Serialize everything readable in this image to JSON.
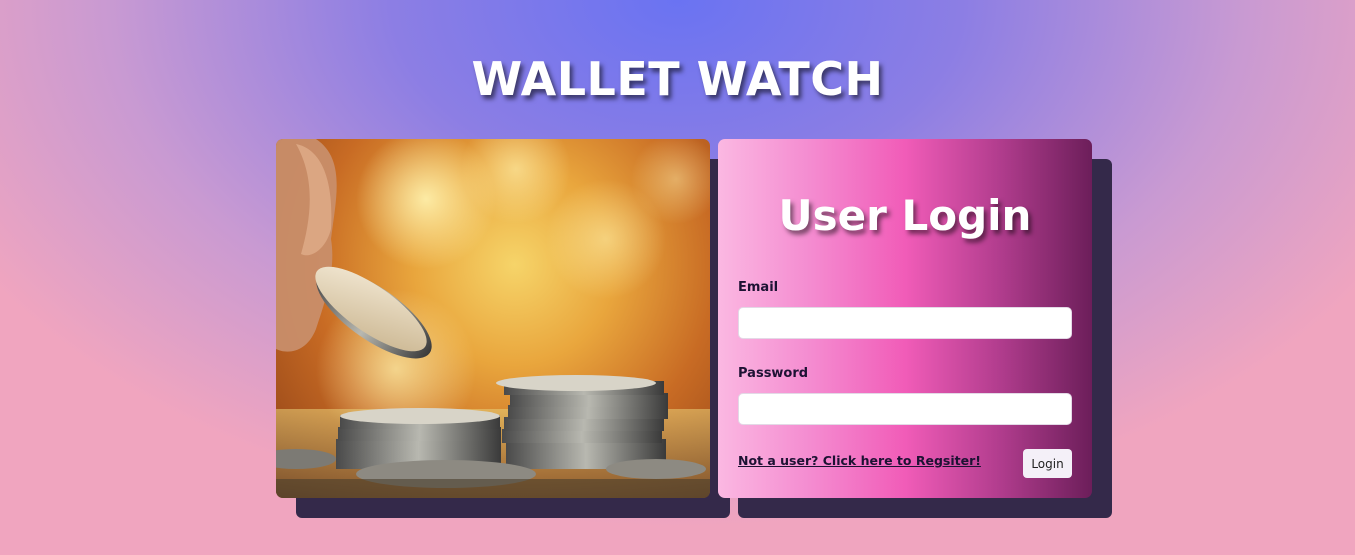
{
  "header": {
    "title": "WALLET WATCH"
  },
  "hero_image": {
    "alt": "hand placing a coin onto stacks of coins"
  },
  "login": {
    "heading": "User Login",
    "email_label": "Email",
    "email_value": "",
    "password_label": "Password",
    "password_value": "",
    "register_link": "Not a user? Click here to Regsiter!",
    "submit_label": "Login"
  },
  "colors": {
    "background_center": "#6a73f2",
    "background_edge": "#f0a5bf",
    "card_shadow": "#34294a",
    "login_gradient_start": "#fbb8e2",
    "login_gradient_mid": "#f15cb8",
    "login_gradient_end": "#6c1e5a"
  }
}
